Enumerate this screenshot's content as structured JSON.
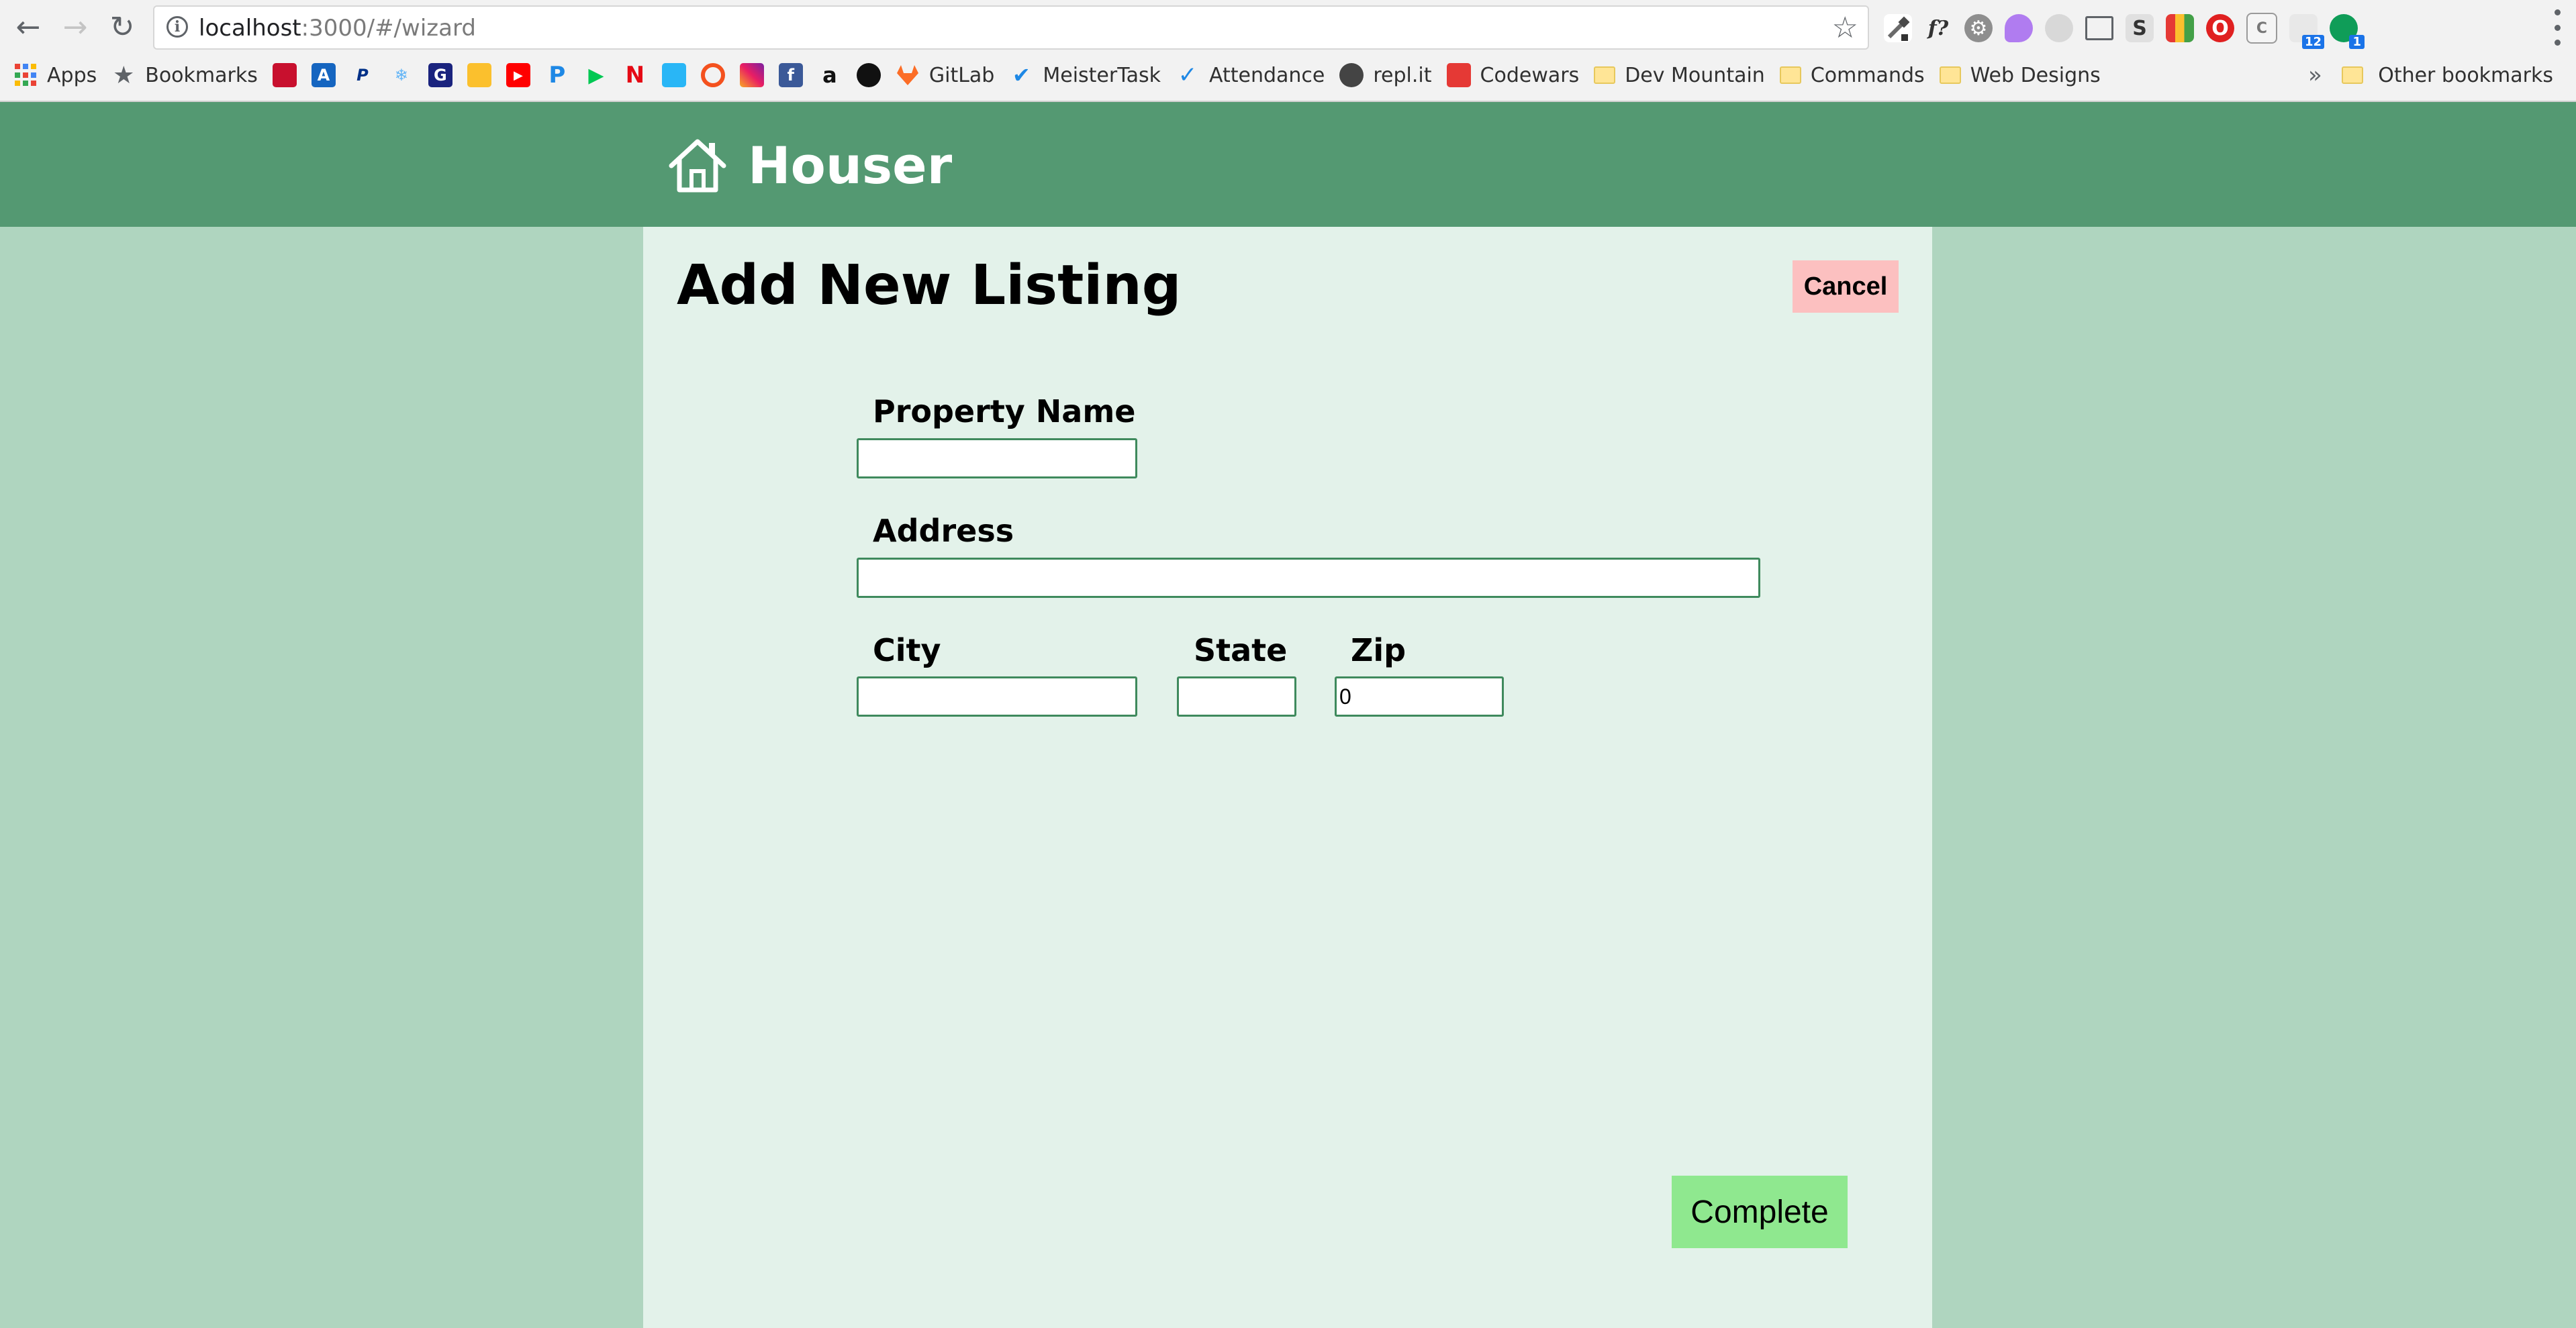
{
  "browser": {
    "url_host": "localhost",
    "url_rest": ":3000/#/wizard",
    "bookmarks": {
      "apps": "Apps",
      "bookmarks": "Bookmarks",
      "gitlab": "GitLab",
      "meistertask": "MeisterTask",
      "attendance": "Attendance",
      "replit": "repl.it",
      "codewars": "Codewars",
      "devmountain": "Dev Mountain",
      "commands": "Commands",
      "webdesigns": "Web Designs",
      "overflow": "»",
      "other": "Other bookmarks"
    },
    "extension_badges": {
      "reader": "12",
      "chat": "1"
    }
  },
  "app": {
    "brand": "Houser",
    "header_color": "#549972"
  },
  "wizard": {
    "title": "Add New Listing",
    "cancel_label": "Cancel",
    "complete_label": "Complete",
    "fields": {
      "property_name": {
        "label": "Property Name",
        "value": ""
      },
      "address": {
        "label": "Address",
        "value": ""
      },
      "city": {
        "label": "City",
        "value": ""
      },
      "state": {
        "label": "State",
        "value": ""
      },
      "zip": {
        "label": "Zip",
        "value": "0"
      }
    }
  }
}
